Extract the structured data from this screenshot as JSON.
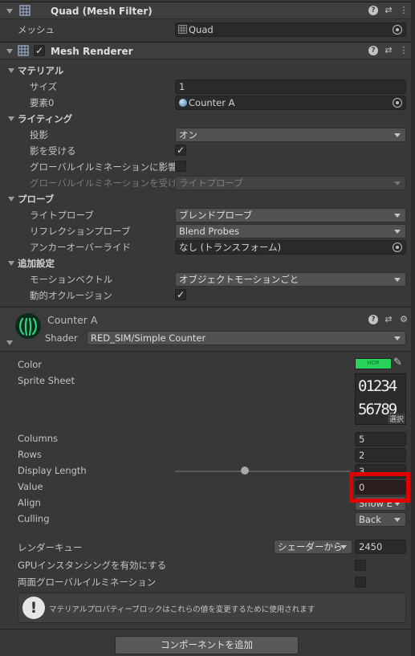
{
  "mesh_filter": {
    "title": "Quad (Mesh Filter)",
    "mesh_label": "メッシュ",
    "mesh_value": "Quad"
  },
  "mesh_renderer": {
    "title": "Mesh Renderer",
    "materials_section": "マテリアル",
    "size_label": "サイズ",
    "size_value": "1",
    "element0_label": "要素0",
    "element0_value": "Counter A",
    "lighting_section": "ライティング",
    "cast_shadows_label": "投影",
    "cast_shadows_value": "オン",
    "receive_shadows_label": "影を受ける",
    "gi_contrib_label": "グローバルイルミネーションに影響",
    "gi_receive_label": "グローバルイルミネーションを受ける",
    "gi_receive_value": "ライトプローブ",
    "probes_section": "プローブ",
    "light_probes_label": "ライトプローブ",
    "light_probes_value": "ブレンドプローブ",
    "reflection_probes_label": "リフレクションプローブ",
    "reflection_probes_value": "Blend Probes",
    "anchor_override_label": "アンカーオーバーライド",
    "anchor_override_value": "なし (トランスフォーム)",
    "additional_section": "追加設定",
    "motion_vectors_label": "モーションベクトル",
    "motion_vectors_value": "オブジェクトモーションごと",
    "dynamic_occlusion_label": "動的オクルージョン"
  },
  "material": {
    "name": "Counter A",
    "shader_label": "Shader",
    "shader_value": "RED_SIM/Simple Counter",
    "color_label": "Color",
    "color_hex": "#27d35a",
    "color_badge": "HDR",
    "sprite_label": "Sprite Sheet",
    "sprite_row1": "01234",
    "sprite_row2": "56789",
    "sprite_select": "選択",
    "columns_label": "Columns",
    "columns_value": "5",
    "rows_label": "Rows",
    "rows_value": "2",
    "display_length_label": "Display Length",
    "display_length_value": "3",
    "display_length_slider": 0.4,
    "value_label": "Value",
    "value_value": "0",
    "align_label": "Align",
    "align_value": "Show E",
    "culling_label": "Culling",
    "culling_value": "Back",
    "render_queue_label": "レンダーキュー",
    "render_queue_mode": "シェーダーから",
    "render_queue_value": "2450",
    "gpu_instancing_label": "GPUインスタンシングを有効にする",
    "double_sided_gi_label": "両面グローバルイルミネーション",
    "info_text": "マテリアルプロパティーブロックはこれらの値を変更するために使用されます"
  },
  "footer": {
    "add_component": "コンポーネントを追加"
  },
  "colors": {
    "highlight": "#e00000",
    "background": "#383838"
  }
}
